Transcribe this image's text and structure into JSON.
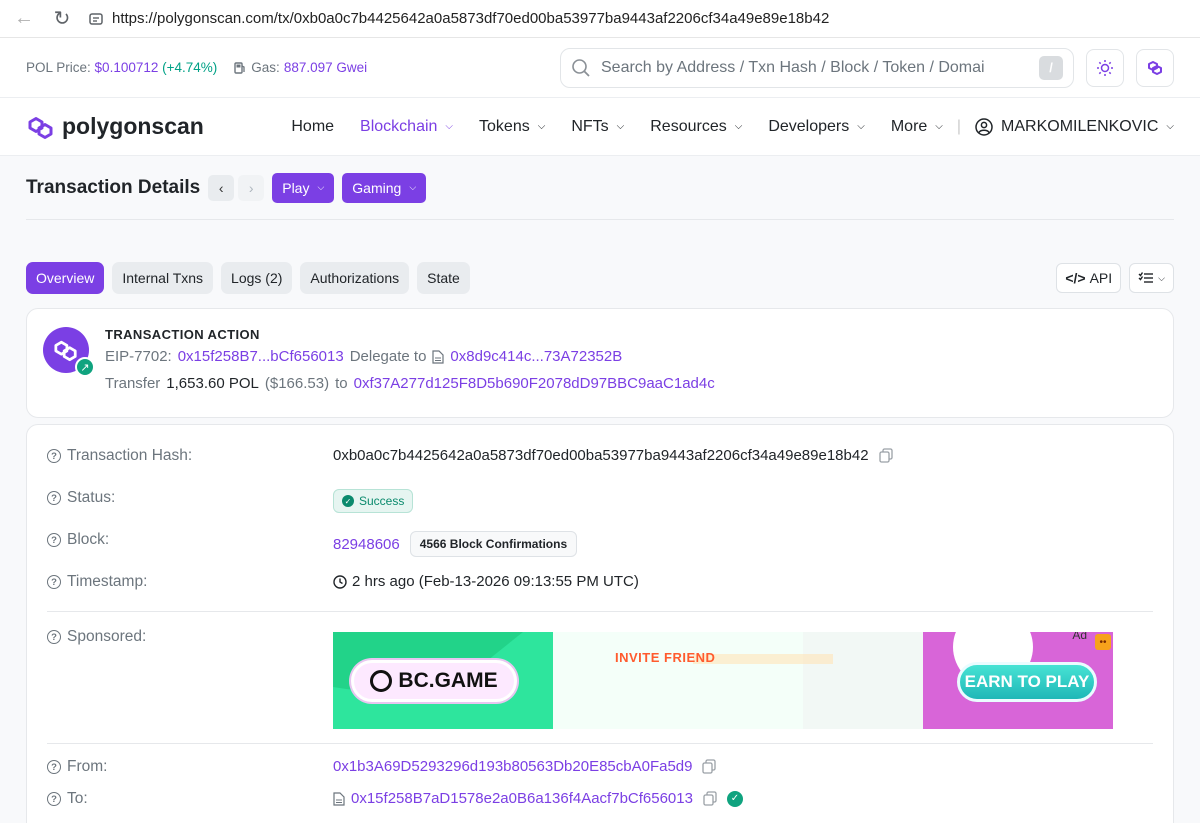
{
  "browser": {
    "url": "https://polygonscan.com/tx/0xb0a0c7b4425642a0a5873df70ed00ba53977ba9443af2206cf34a49e89e18b42"
  },
  "topbar": {
    "price_label": "POL Price:",
    "price_value": "$0.100712",
    "price_change": "(+4.74%)",
    "gas_label": "Gas:",
    "gas_value": "887.097 Gwei",
    "search_placeholder": "Search by Address / Txn Hash / Block / Token / Domai",
    "search_shortcut": "/"
  },
  "nav": {
    "logo": "polygonscan",
    "items": [
      {
        "label": "Home"
      },
      {
        "label": "Blockchain"
      },
      {
        "label": "Tokens"
      },
      {
        "label": "NFTs"
      },
      {
        "label": "Resources"
      },
      {
        "label": "Developers"
      },
      {
        "label": "More"
      }
    ],
    "user": "MARKOMILENKOVIC"
  },
  "page": {
    "title": "Transaction Details",
    "play": "Play",
    "gaming": "Gaming"
  },
  "tabs": [
    {
      "label": "Overview"
    },
    {
      "label": "Internal Txns"
    },
    {
      "label": "Logs (2)"
    },
    {
      "label": "Authorizations"
    },
    {
      "label": "State"
    }
  ],
  "api_label": "API",
  "action": {
    "title": "TRANSACTION ACTION",
    "eip_prefix": "EIP-7702:",
    "eip_addr": "0x15f258B7...bCf656013",
    "delegate_text": "Delegate to",
    "delegate_addr": "0x8d9c414c...73A72352B",
    "transfer_text": "Transfer",
    "transfer_amount": "1,653.60 POL",
    "transfer_usd": "($166.53)",
    "to_text": "to",
    "to_addr": "0xf37A277d125F8D5b690F2078dD97BBC9aaC1ad4c"
  },
  "details": {
    "hash_label": "Transaction Hash:",
    "hash_value": "0xb0a0c7b4425642a0a5873df70ed00ba53977ba9443af2206cf34a49e89e18b42",
    "status_label": "Status:",
    "status_value": "Success",
    "block_label": "Block:",
    "block_value": "82948606",
    "block_confirmations": "4566 Block Confirmations",
    "timestamp_label": "Timestamp:",
    "timestamp_value": "2 hrs ago (Feb-13-2026 09:13:55 PM UTC)",
    "sponsored_label": "Sponsored:",
    "ad": {
      "brand": "BC.GAME",
      "invite": "INVITE FRIEND",
      "cta": "EARN TO PLAY",
      "ad_tag": "Ad"
    },
    "from_label": "From:",
    "from_value": "0x1b3A69D5293296d193b80563Db20E85cbA0Fa5d9",
    "to_label": "To:",
    "to_value": "0x15f258B7aD1578e2a0B6a136f4Aacf7bCf656013"
  },
  "colors": {
    "accent": "#7b3fe4",
    "success": "#0b8a6d"
  }
}
